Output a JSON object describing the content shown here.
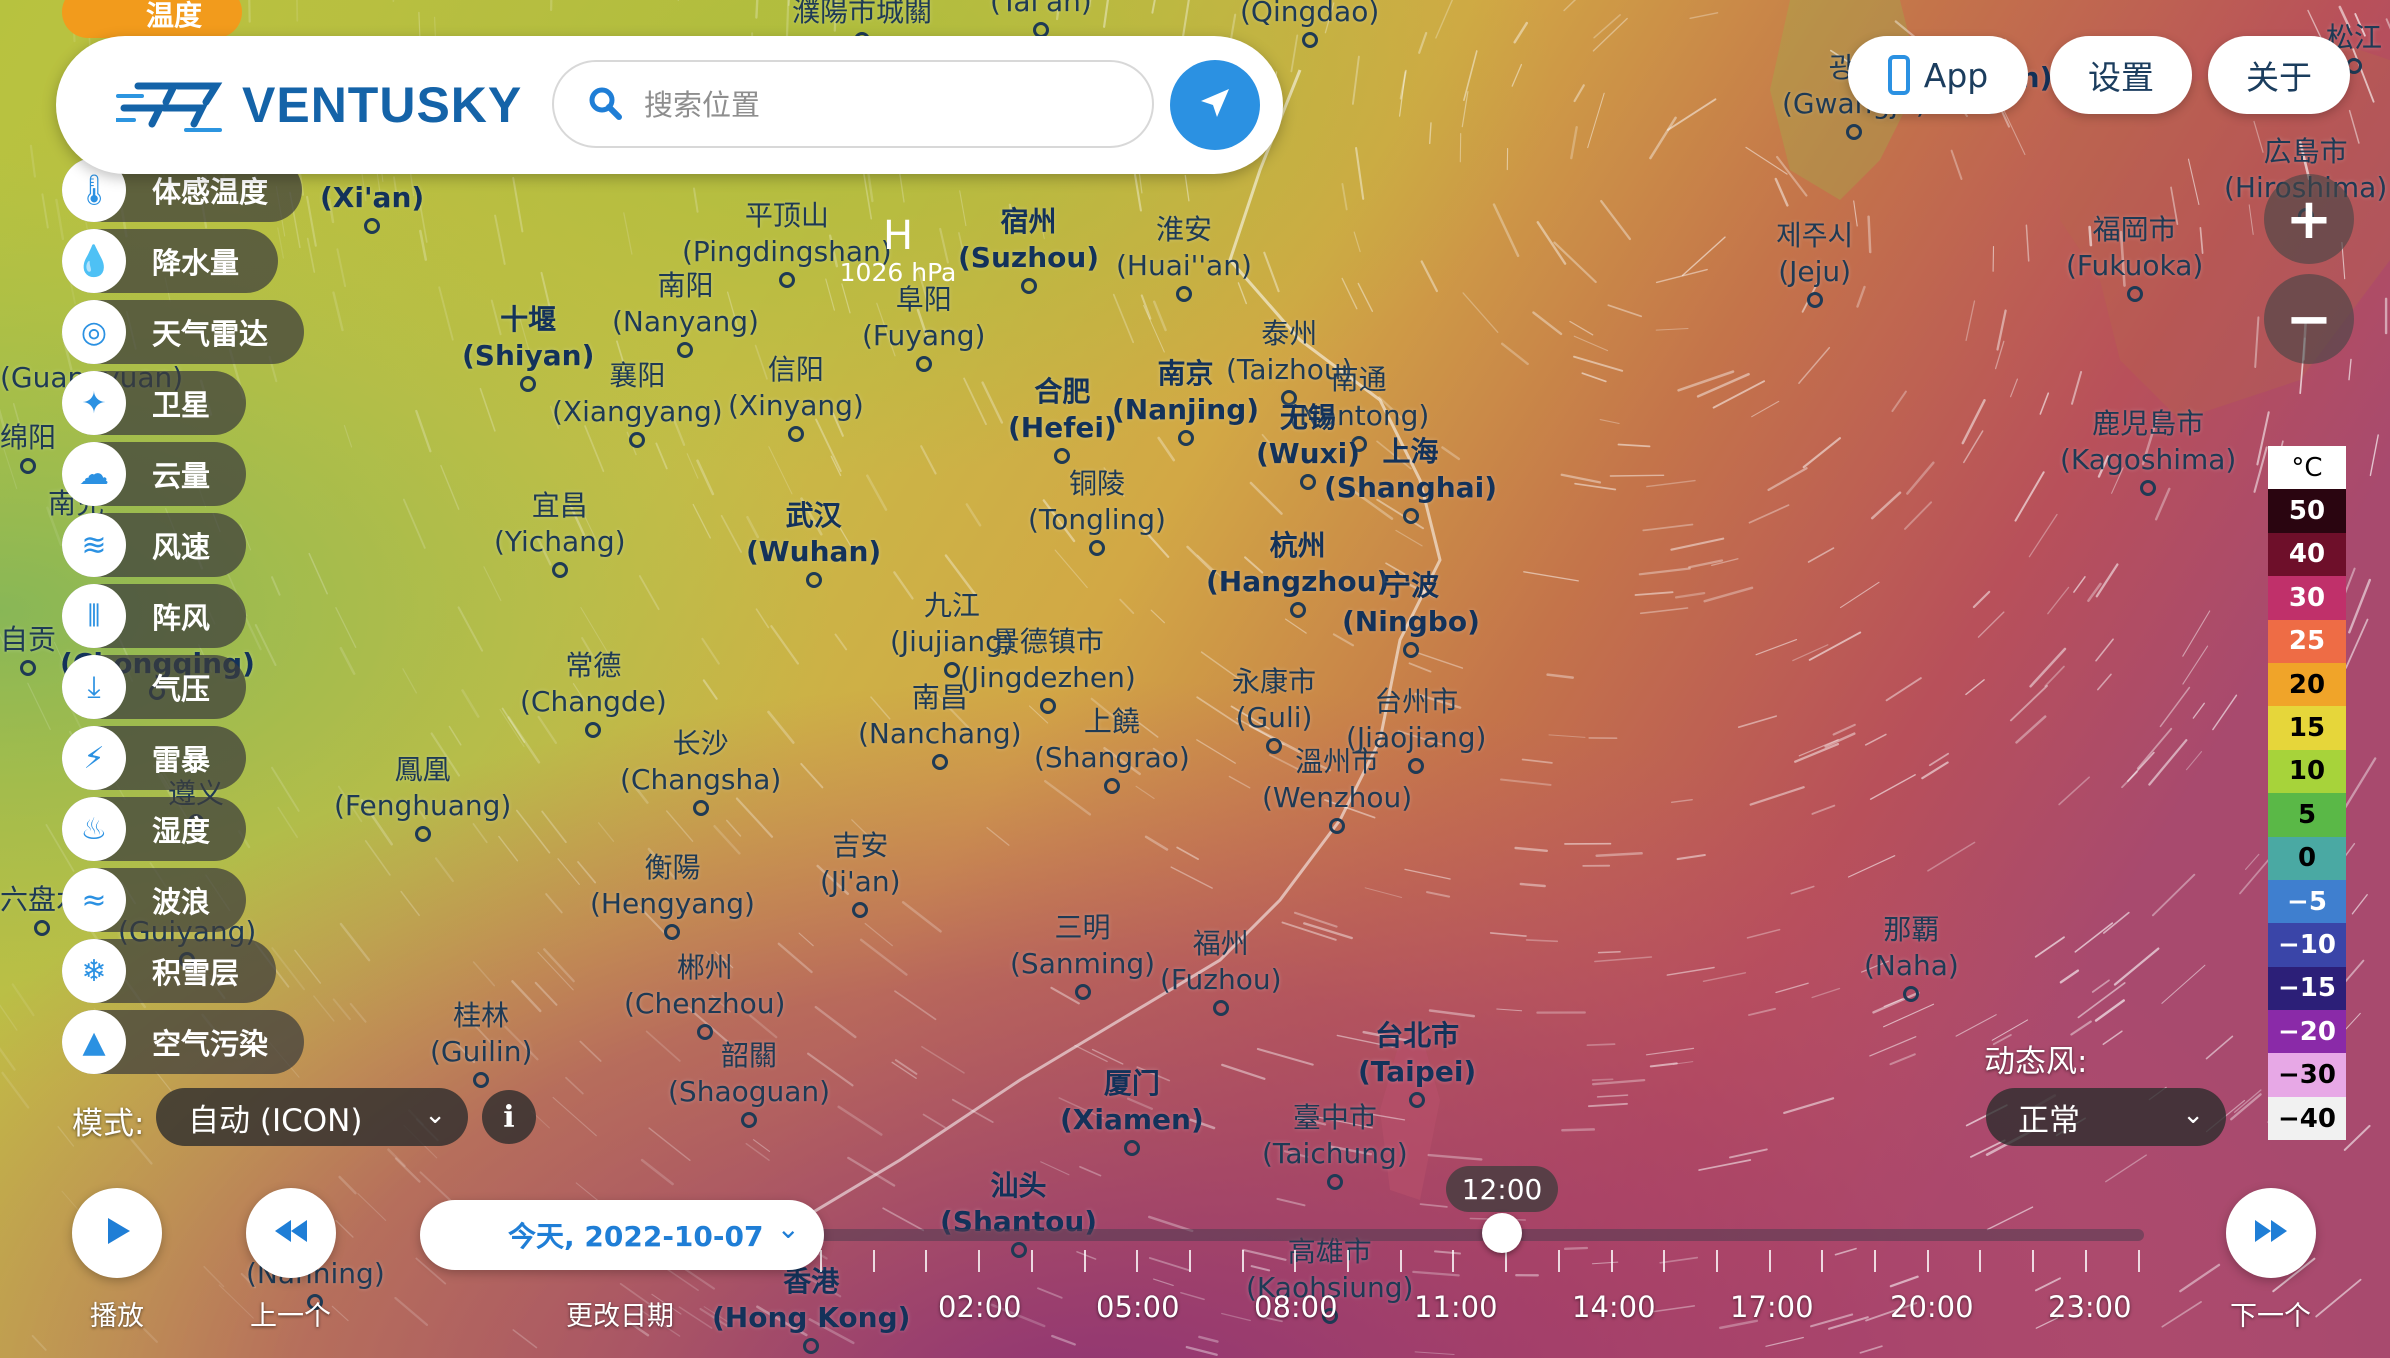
{
  "header": {
    "logo_text": "VENTUSKY",
    "search_placeholder": "搜索位置"
  },
  "top_buttons": {
    "app_label": "App",
    "settings_label": "设置",
    "about_label": "关于"
  },
  "layers": [
    {
      "label": "体感温度",
      "icon": "thermometer-icon"
    },
    {
      "label": "降水量",
      "icon": "raindrop-icon"
    },
    {
      "label": "天气雷达",
      "icon": "radar-icon"
    },
    {
      "label": "卫星",
      "icon": "satellite-icon"
    },
    {
      "label": "云量",
      "icon": "cloud-icon"
    },
    {
      "label": "风速",
      "icon": "wind-icon"
    },
    {
      "label": "阵风",
      "icon": "gust-icon"
    },
    {
      "label": "气压",
      "icon": "pressure-icon"
    },
    {
      "label": "雷暴",
      "icon": "lightning-icon"
    },
    {
      "label": "湿度",
      "icon": "humidity-icon"
    },
    {
      "label": "波浪",
      "icon": "waves-icon"
    },
    {
      "label": "积雪层",
      "icon": "snowflake-icon"
    },
    {
      "label": "空气污染",
      "icon": "air-pollution-icon"
    }
  ],
  "layer_top_partial": "温度",
  "model": {
    "label": "模式:",
    "value": "自动 (ICON)"
  },
  "dynamic_wind": {
    "label": "动态风:",
    "value": "正常"
  },
  "legend": {
    "unit": "°C",
    "entries": [
      {
        "value": "50",
        "color": "#2a0510",
        "text": "#ffffff"
      },
      {
        "value": "40",
        "color": "#6e0f2a",
        "text": "#ffffff"
      },
      {
        "value": "30",
        "color": "#c0306a",
        "text": "#ffffff"
      },
      {
        "value": "25",
        "color": "#ee6c45",
        "text": "#ffffff"
      },
      {
        "value": "20",
        "color": "#f0a429",
        "text": "#000000"
      },
      {
        "value": "15",
        "color": "#e6d63a",
        "text": "#000000"
      },
      {
        "value": "10",
        "color": "#a7d33a",
        "text": "#000000"
      },
      {
        "value": "5",
        "color": "#5ab847",
        "text": "#000000"
      },
      {
        "value": "0",
        "color": "#4aa9a3",
        "text": "#000000"
      },
      {
        "value": "−5",
        "color": "#3f7fcf",
        "text": "#ffffff"
      },
      {
        "value": "−10",
        "color": "#3a45a8",
        "text": "#ffffff"
      },
      {
        "value": "−15",
        "color": "#2c1f78",
        "text": "#ffffff"
      },
      {
        "value": "−20",
        "color": "#8a2aa8",
        "text": "#ffffff"
      },
      {
        "value": "−30",
        "color": "#e7a8e6",
        "text": "#000000"
      },
      {
        "value": "−40",
        "color": "#f1f1f1",
        "text": "#000000"
      }
    ]
  },
  "timeline": {
    "play_label": "播放",
    "prev_label": "上一个",
    "next_label": "下一个",
    "change_date_label": "更改日期",
    "date_value": "今天, 2022-10-07",
    "current_time": "12:00",
    "hours": [
      "02:00",
      "05:00",
      "08:00",
      "11:00",
      "14:00",
      "17:00",
      "20:00",
      "23:00"
    ]
  },
  "pressure_center": {
    "letter": "H",
    "value": "1026 hPa"
  },
  "cities": [
    {
      "zh": "濮陽市城關",
      "en": ""
    },
    {
      "zh": "",
      "en": "(Tai'an)"
    },
    {
      "zh": "",
      "en": "(Qingdao)"
    },
    {
      "zh": "平顶山",
      "en": "(Pingdingshan)"
    },
    {
      "zh": "南阳",
      "en": "(Nanyang)"
    },
    {
      "zh": "宿州",
      "en": "(Suzhou)"
    },
    {
      "zh": "淮安",
      "en": "(Huai''an)"
    },
    {
      "zh": "阜阳",
      "en": "(Fuyang)"
    },
    {
      "zh": "十堰",
      "en": "(Shiyan)"
    },
    {
      "zh": "襄阳",
      "en": "(Xiangyang)"
    },
    {
      "zh": "信阳",
      "en": "(Xinyang)"
    },
    {
      "zh": "合肥",
      "en": "(Hefei)"
    },
    {
      "zh": "南京",
      "en": "(Nanjing)"
    },
    {
      "zh": "泰州",
      "en": "(Taizhou)"
    },
    {
      "zh": "南通",
      "en": "(Nantong)"
    },
    {
      "zh": "无锡",
      "en": "(Wuxi)"
    },
    {
      "zh": "上海",
      "en": "(Shanghai)"
    },
    {
      "zh": "宜昌",
      "en": "(Yichang)"
    },
    {
      "zh": "武汉",
      "en": "(Wuhan)"
    },
    {
      "zh": "铜陵",
      "en": "(Tongling)"
    },
    {
      "zh": "杭州",
      "en": "(Hangzhou)"
    },
    {
      "zh": "宁波",
      "en": "(Ningbo)"
    },
    {
      "zh": "九江",
      "en": "(Jiujiang)"
    },
    {
      "zh": "景德镇市",
      "en": "(Jingdezhen)"
    },
    {
      "zh": "常德",
      "en": "(Changde)"
    },
    {
      "zh": "南昌",
      "en": "(Nanchang)"
    },
    {
      "zh": "上饒",
      "en": "(Shangrao)"
    },
    {
      "zh": "永康市",
      "en": "(Guli)"
    },
    {
      "zh": "台州市",
      "en": "(Jiaojiang)"
    },
    {
      "zh": "溫州市",
      "en": "(Wenzhou)"
    },
    {
      "zh": "鳳凰",
      "en": "(Fenghuang)"
    },
    {
      "zh": "长沙",
      "en": "(Changsha)"
    },
    {
      "zh": "吉安",
      "en": "(Ji'an)"
    },
    {
      "zh": "衡陽",
      "en": "(Hengyang)"
    },
    {
      "zh": "三明",
      "en": "(Sanming)"
    },
    {
      "zh": "福州",
      "en": "(Fuzhou)"
    },
    {
      "zh": "郴州",
      "en": "(Chenzhou)"
    },
    {
      "zh": "桂林",
      "en": "(Guilin)"
    },
    {
      "zh": "韶關",
      "en": "(Shaoguan)"
    },
    {
      "zh": "台北市",
      "en": "(Taipei)"
    },
    {
      "zh": "厦门",
      "en": "(Xiamen)"
    },
    {
      "zh": "臺中市",
      "en": "(Taichung)"
    },
    {
      "zh": "汕头",
      "en": "(Shantou)"
    },
    {
      "zh": "高雄市",
      "en": "(Kaohsiung)"
    },
    {
      "zh": "香港",
      "en": "(Hong Kong)"
    },
    {
      "zh": "",
      "en": "(Xi'an)"
    },
    {
      "zh": "",
      "en": "(Nanning)"
    },
    {
      "zh": "遵义",
      "en": ""
    },
    {
      "zh": "",
      "en": "(Guiyang)"
    },
    {
      "zh": "",
      "en": "(Chongqing)"
    },
    {
      "zh": "南充",
      "en": ""
    },
    {
      "zh": "自贡",
      "en": ""
    },
    {
      "zh": "六盘水",
      "en": ""
    },
    {
      "zh": "绵阳",
      "en": ""
    },
    {
      "zh": "",
      "en": "(Guangyuan)"
    },
    {
      "zh": "광주",
      "en": "(Gwangju)"
    },
    {
      "zh": "",
      "en": "(Busan)"
    },
    {
      "zh": "제주시",
      "en": "(Jeju)"
    },
    {
      "zh": "福岡市",
      "en": "(Fukuoka)"
    },
    {
      "zh": "広島市",
      "en": "(Hiroshima)"
    },
    {
      "zh": "鹿児島市",
      "en": "(Kagoshima)"
    },
    {
      "zh": "那覇",
      "en": "(Naha)"
    },
    {
      "zh": "松江",
      "en": ""
    }
  ]
}
